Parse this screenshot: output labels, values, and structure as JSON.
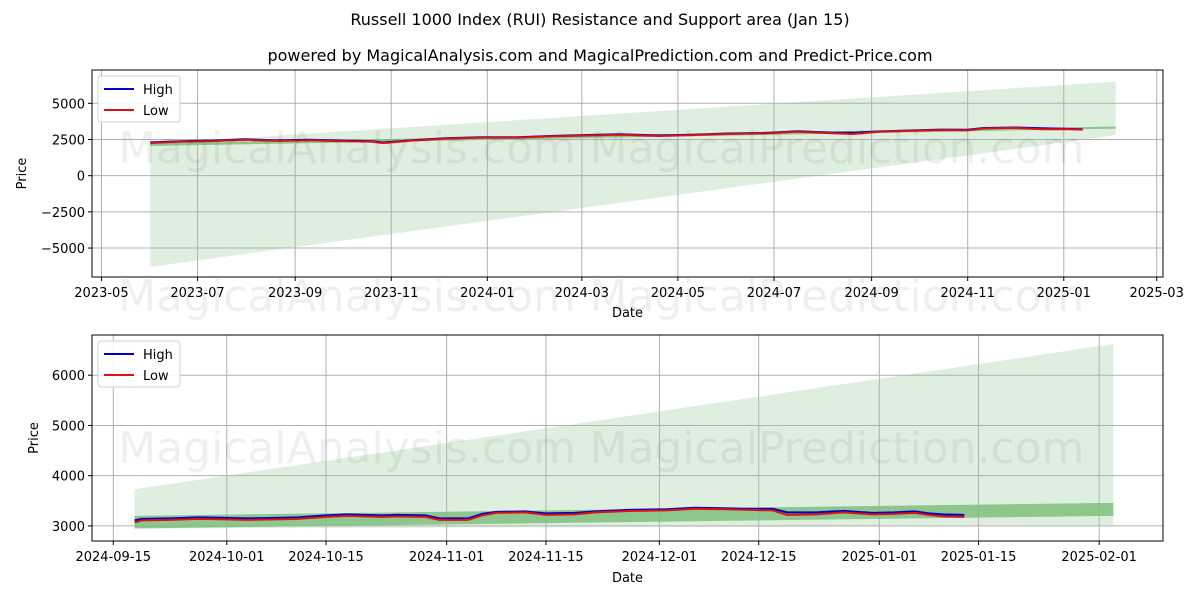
{
  "title": "Russell 1000 Index (RUI) Resistance and Support area (Jan 15)",
  "subtitle": "powered by MagicalAnalysis.com and MagicalPrediction.com and Predict-Price.com",
  "watermarks": [
    "MagicalAnalysis.com",
    "MagicalPrediction.com"
  ],
  "colors": {
    "high": "#0000cc",
    "low": "#dd1111",
    "band_light": "#d4ead4",
    "band_dark": "#7fbf7f",
    "grid": "#b0b0b0"
  },
  "chart_data": [
    {
      "type": "line",
      "title": "",
      "xlabel": "Date",
      "ylabel": "Price",
      "x_ticks": [
        "2023-05",
        "2023-07",
        "2023-09",
        "2023-11",
        "2024-01",
        "2024-03",
        "2024-05",
        "2024-07",
        "2024-09",
        "2024-11",
        "2025-01",
        "2025-03"
      ],
      "x_range": [
        "2023-04-25",
        "2025-03-05"
      ],
      "y_ticks": [
        5000,
        2500,
        0,
        -2500,
        -5000
      ],
      "y_tick_labels": [
        "5000",
        "2500",
        "0",
        "−2500",
        "−5000"
      ],
      "ylim": [
        -7000,
        7300
      ],
      "grid": true,
      "legend": {
        "position": "top-left",
        "entries": [
          "High",
          "Low"
        ]
      },
      "wide_band": {
        "x": [
          "2023-06-01",
          "2025-02-03"
        ],
        "upper": [
          2200,
          6500
        ],
        "lower": [
          -6300,
          2800
        ]
      },
      "narrow_band": {
        "x": [
          "2023-06-01",
          "2025-02-03"
        ],
        "upper": [
          2250,
          3400
        ],
        "lower": [
          2050,
          3250
        ]
      },
      "series": [
        {
          "name": "High",
          "x": [
            "2023-06-01",
            "2023-06-20",
            "2023-07-10",
            "2023-07-31",
            "2023-08-20",
            "2023-09-10",
            "2023-09-30",
            "2023-10-20",
            "2023-10-27",
            "2023-11-15",
            "2023-12-05",
            "2023-12-28",
            "2024-01-20",
            "2024-02-10",
            "2024-03-01",
            "2024-03-25",
            "2024-04-19",
            "2024-05-10",
            "2024-06-01",
            "2024-06-25",
            "2024-07-16",
            "2024-08-05",
            "2024-08-20",
            "2024-09-06",
            "2024-09-25",
            "2024-10-15",
            "2024-11-01",
            "2024-11-11",
            "2024-12-01",
            "2024-12-18",
            "2025-01-01",
            "2025-01-13"
          ],
          "values": [
            2300,
            2380,
            2420,
            2510,
            2440,
            2480,
            2420,
            2380,
            2290,
            2460,
            2580,
            2660,
            2660,
            2740,
            2800,
            2860,
            2780,
            2830,
            2910,
            2950,
            3070,
            2980,
            2970,
            3060,
            3120,
            3180,
            3170,
            3290,
            3330,
            3280,
            3240,
            3210
          ]
        },
        {
          "name": "Low",
          "x": [
            "2023-06-01",
            "2023-06-20",
            "2023-07-10",
            "2023-07-31",
            "2023-08-20",
            "2023-09-10",
            "2023-09-30",
            "2023-10-20",
            "2023-10-27",
            "2023-11-15",
            "2023-12-05",
            "2023-12-28",
            "2024-01-20",
            "2024-02-10",
            "2024-03-01",
            "2024-03-25",
            "2024-04-19",
            "2024-05-10",
            "2024-06-01",
            "2024-06-25",
            "2024-07-16",
            "2024-08-05",
            "2024-08-20",
            "2024-09-06",
            "2024-09-25",
            "2024-10-15",
            "2024-11-01",
            "2024-11-11",
            "2024-12-01",
            "2024-12-18",
            "2025-01-01",
            "2025-01-13"
          ],
          "values": [
            2260,
            2340,
            2390,
            2480,
            2400,
            2450,
            2390,
            2340,
            2250,
            2430,
            2550,
            2630,
            2630,
            2710,
            2770,
            2830,
            2740,
            2800,
            2880,
            2920,
            3030,
            2940,
            2880,
            3030,
            3090,
            3150,
            3130,
            3260,
            3300,
            3210,
            3220,
            3180
          ]
        }
      ]
    },
    {
      "type": "line",
      "title": "",
      "xlabel": "Date",
      "ylabel": "Price",
      "x_ticks": [
        "2024-09-15",
        "2024-10-01",
        "2024-10-15",
        "2024-11-01",
        "2024-11-15",
        "2024-12-01",
        "2024-12-15",
        "2025-01-01",
        "2025-01-15",
        "2025-02-01"
      ],
      "x_range": [
        "2024-09-12",
        "2025-02-10"
      ],
      "y_ticks": [
        6000,
        5000,
        4000,
        3000
      ],
      "y_tick_labels": [
        "6000",
        "5000",
        "4000",
        "3000"
      ],
      "ylim": [
        2700,
        6800
      ],
      "grid": true,
      "legend": {
        "position": "top-left",
        "entries": [
          "High",
          "Low"
        ]
      },
      "wide_band": {
        "x": [
          "2024-09-18",
          "2025-02-03"
        ],
        "upper": [
          3730,
          6620
        ],
        "lower": [
          2950,
          3000
        ]
      },
      "narrow_band": {
        "x": [
          "2024-09-18",
          "2025-02-03"
        ],
        "upper": [
          3200,
          3460
        ],
        "lower": [
          2950,
          3200
        ]
      },
      "series": [
        {
          "name": "High",
          "x": [
            "2024-09-18",
            "2024-09-19",
            "2024-09-23",
            "2024-09-27",
            "2024-10-01",
            "2024-10-04",
            "2024-10-08",
            "2024-10-11",
            "2024-10-15",
            "2024-10-18",
            "2024-10-23",
            "2024-10-25",
            "2024-10-29",
            "2024-10-31",
            "2024-11-04",
            "2024-11-06",
            "2024-11-08",
            "2024-11-12",
            "2024-11-15",
            "2024-11-19",
            "2024-11-22",
            "2024-11-27",
            "2024-12-02",
            "2024-12-06",
            "2024-12-10",
            "2024-12-13",
            "2024-12-17",
            "2024-12-19",
            "2024-12-23",
            "2024-12-27",
            "2024-12-31",
            "2025-01-03",
            "2025-01-06",
            "2025-01-08",
            "2025-01-10",
            "2025-01-13"
          ],
          "values": [
            3110,
            3140,
            3150,
            3170,
            3160,
            3150,
            3160,
            3170,
            3210,
            3230,
            3210,
            3220,
            3210,
            3150,
            3150,
            3240,
            3280,
            3290,
            3250,
            3260,
            3290,
            3320,
            3330,
            3360,
            3350,
            3340,
            3340,
            3270,
            3270,
            3300,
            3260,
            3270,
            3290,
            3250,
            3230,
            3220
          ]
        },
        {
          "name": "Low",
          "x": [
            "2024-09-18",
            "2024-09-19",
            "2024-09-23",
            "2024-09-27",
            "2024-10-01",
            "2024-10-04",
            "2024-10-08",
            "2024-10-11",
            "2024-10-15",
            "2024-10-18",
            "2024-10-23",
            "2024-10-25",
            "2024-10-29",
            "2024-10-31",
            "2024-11-04",
            "2024-11-06",
            "2024-11-08",
            "2024-11-12",
            "2024-11-15",
            "2024-11-19",
            "2024-11-22",
            "2024-11-27",
            "2024-12-02",
            "2024-12-06",
            "2024-12-10",
            "2024-12-13",
            "2024-12-17",
            "2024-12-19",
            "2024-12-23",
            "2024-12-27",
            "2024-12-31",
            "2025-01-03",
            "2025-01-06",
            "2025-01-08",
            "2025-01-10",
            "2025-01-13"
          ],
          "values": [
            3070,
            3110,
            3120,
            3140,
            3130,
            3120,
            3130,
            3140,
            3180,
            3200,
            3180,
            3190,
            3180,
            3120,
            3120,
            3210,
            3260,
            3270,
            3220,
            3230,
            3270,
            3300,
            3310,
            3340,
            3330,
            3320,
            3310,
            3220,
            3230,
            3270,
            3230,
            3240,
            3260,
            3220,
            3190,
            3180
          ]
        }
      ]
    }
  ]
}
